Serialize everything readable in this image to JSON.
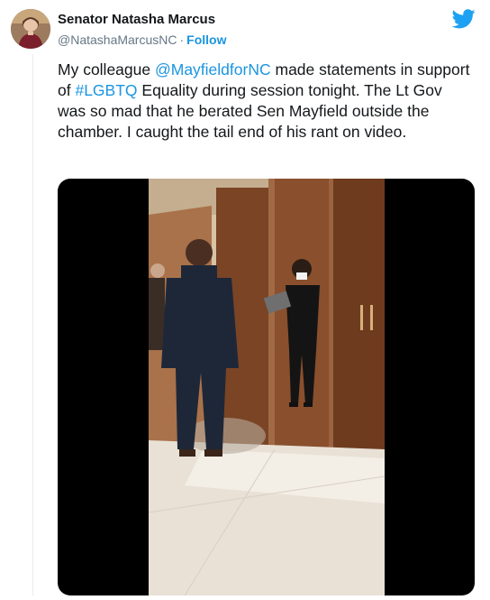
{
  "tweet": {
    "display_name": "Senator Natasha Marcus",
    "handle": "@NatashaMarcusNC",
    "separator": "·",
    "follow_label": "Follow",
    "text": {
      "part1": "My colleague ",
      "mention": "@MayfieldforNC",
      "part2": " made statements in support of ",
      "hashtag": "#LGBTQ",
      "part3": " Equality during session tonight. The Lt Gov was so mad that he berated Sen Mayfield outside the chamber. I caught the tail end of his rant on video."
    }
  },
  "icons": {
    "brand": "twitter-bird-icon",
    "avatar": "profile-photo"
  },
  "colors": {
    "link": "#1b95e0",
    "handle": "#657786",
    "text": "#14171a",
    "video_background": "#000000"
  }
}
